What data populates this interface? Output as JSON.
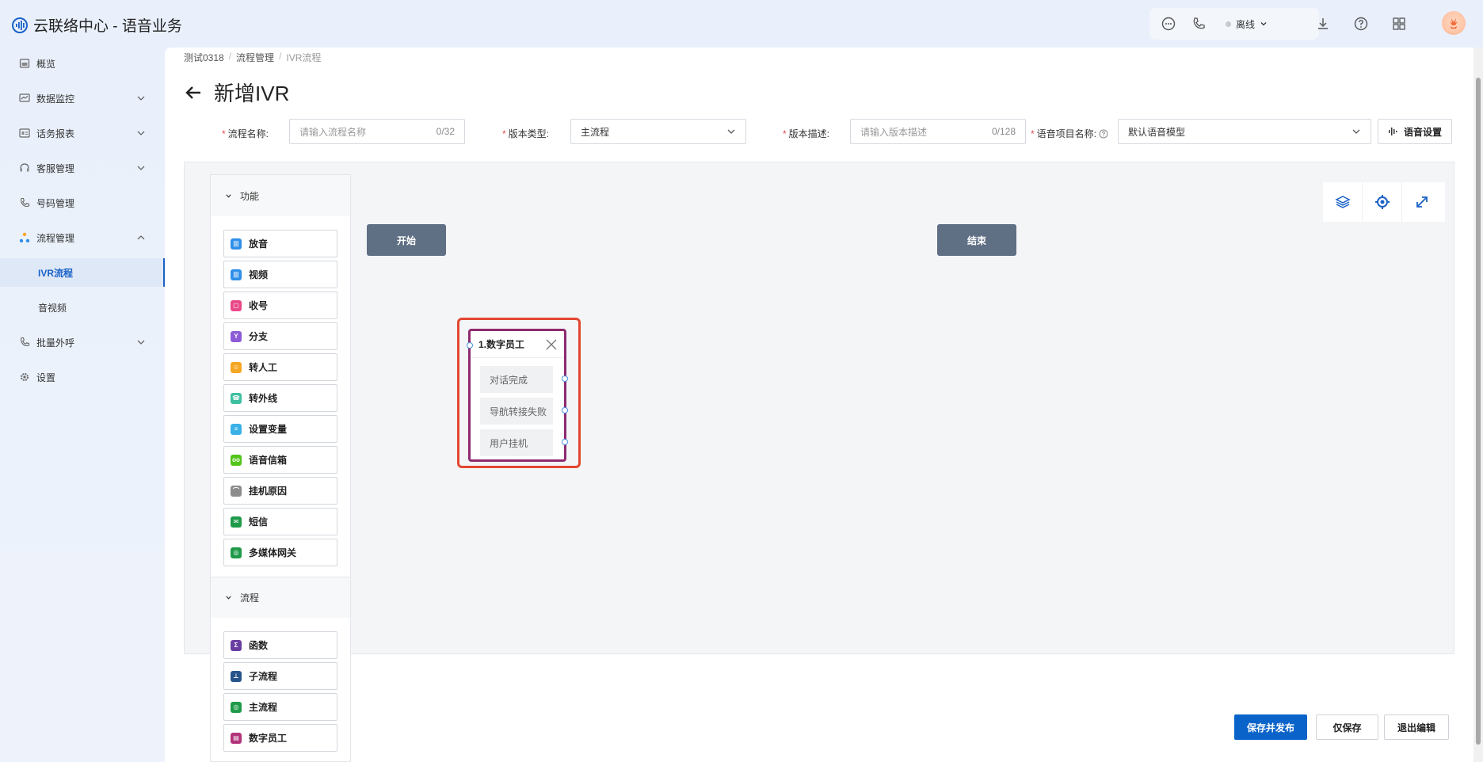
{
  "brand": {
    "title": "云联络中心 - 语音业务"
  },
  "topbar": {
    "status": "离线"
  },
  "sidebar": {
    "items": [
      {
        "label": "概览"
      },
      {
        "label": "数据监控"
      },
      {
        "label": "话务报表"
      },
      {
        "label": "客服管理"
      },
      {
        "label": "号码管理"
      },
      {
        "label": "流程管理"
      },
      {
        "label": "IVR流程"
      },
      {
        "label": "音视频"
      },
      {
        "label": "批量外呼"
      },
      {
        "label": "设置"
      }
    ]
  },
  "breadcrumb": [
    "测试0318",
    "流程管理",
    "IVR流程"
  ],
  "page": {
    "title": "新增IVR"
  },
  "form": {
    "name_label": "流程名称:",
    "name_placeholder": "请输入流程名称",
    "name_count": "0/32",
    "type_label": "版本类型:",
    "type_value": "主流程",
    "desc_label": "版本描述:",
    "desc_placeholder": "请输入版本描述",
    "desc_count": "0/128",
    "voice_label": "语音项目名称:",
    "voice_value": "默认语音模型",
    "voice_button": "语音设置"
  },
  "palette": {
    "section1": "功能",
    "section2": "流程",
    "functions": [
      {
        "label": "放音",
        "color": "#2f8fe8"
      },
      {
        "label": "视频",
        "color": "#2f8fe8"
      },
      {
        "label": "收号",
        "color": "#e84a8a"
      },
      {
        "label": "分支",
        "color": "#8d5bd6"
      },
      {
        "label": "转人工",
        "color": "#f5a623"
      },
      {
        "label": "转外线",
        "color": "#3dbfa0"
      },
      {
        "label": "设置变量",
        "color": "#3ab0e6"
      },
      {
        "label": "语音信箱",
        "color": "#52c41a"
      },
      {
        "label": "挂机原因",
        "color": "#8c8c8c"
      },
      {
        "label": "短信",
        "color": "#1f9a4a"
      },
      {
        "label": "多媒体网关",
        "color": "#1f9a4a"
      }
    ],
    "flows": [
      {
        "label": "函数",
        "color": "#6a3ea1"
      },
      {
        "label": "子流程",
        "color": "#27558a"
      },
      {
        "label": "主流程",
        "color": "#1f9a4a"
      },
      {
        "label": "数字员工",
        "color": "#b2337a"
      }
    ]
  },
  "canvas": {
    "start": "开始",
    "end": "结束",
    "node": {
      "title": "1.数字员工",
      "options": [
        "对话完成",
        "导航转接失败",
        "用户挂机"
      ]
    }
  },
  "actions": {
    "publish": "保存并发布",
    "save": "仅保存",
    "exit": "退出编辑"
  }
}
